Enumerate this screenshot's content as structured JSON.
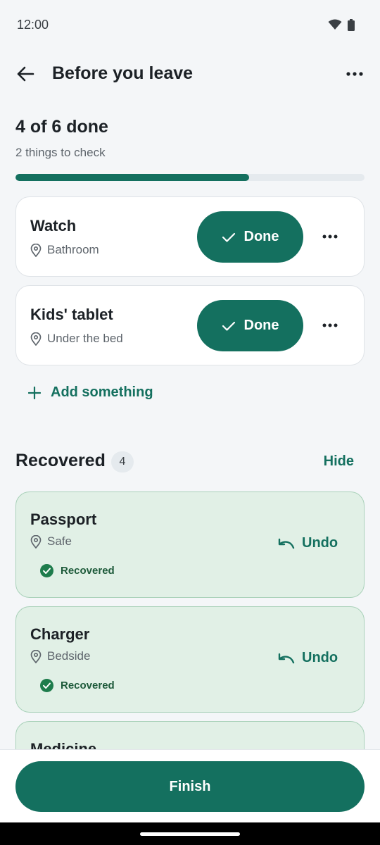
{
  "status_bar": {
    "time": "12:00",
    "icons": [
      "wifi-icon",
      "battery-icon"
    ]
  },
  "header": {
    "title": "Before you leave",
    "back_icon": "arrow-left-icon",
    "menu_icon": "more-horizontal-icon"
  },
  "progress": {
    "heading": "4 of 6 done",
    "subtext": "2 things to check",
    "fraction": 0.67
  },
  "pending_items": [
    {
      "name": "Watch",
      "location": "Bathroom",
      "action_label": "Done"
    },
    {
      "name": "Kids' tablet",
      "location": "Under the bed",
      "action_label": "Done"
    }
  ],
  "add_label": "Add something",
  "recovered_section": {
    "title": "Recovered",
    "count": "4",
    "toggle_label": "Hide",
    "items": [
      {
        "name": "Passport",
        "location": "Safe",
        "status": "Recovered",
        "action_label": "Undo"
      },
      {
        "name": "Charger",
        "location": "Bedside",
        "status": "Recovered",
        "action_label": "Undo"
      },
      {
        "name": "Medicine"
      }
    ]
  },
  "footer": {
    "finish_label": "Finish"
  },
  "colors": {
    "accent": "#14705f",
    "background": "#f4f6f8",
    "recovered_bg": "#e1f0e6",
    "recovered_border": "#a9d1b9",
    "recovered_check": "#1e7c4c"
  }
}
